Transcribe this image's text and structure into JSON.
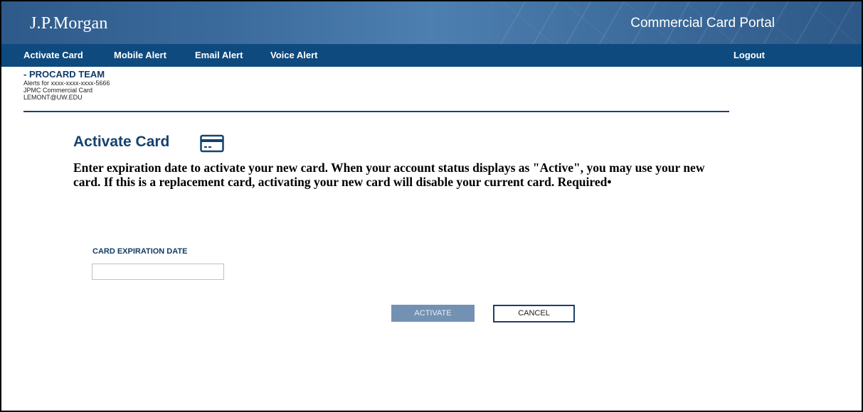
{
  "header": {
    "logo": "J.P.Morgan",
    "portal_title": "Commercial Card Portal"
  },
  "nav": {
    "items": [
      {
        "label": "Activate Card"
      },
      {
        "label": "Mobile Alert"
      },
      {
        "label": "Email Alert"
      },
      {
        "label": "Voice Alert"
      }
    ],
    "logout_label": "Logout"
  },
  "account": {
    "name": "- PROCARD TEAM",
    "alerts_for": "Alerts for xxxx-xxxx-xxxx-5666",
    "program": "JPMC Commercial Card",
    "email": "LEMONT@UW.EDU"
  },
  "main": {
    "title": "Activate Card",
    "title_icon": "credit-card-icon",
    "instructions": "Enter expiration date to activate your new card. When your account status displays as \"Active\", you may use your new card. If this is a replacement card, activating your new card will disable your current card. Required•",
    "field_label": "CARD EXPIRATION DATE",
    "field_value": "",
    "activate_label": "ACTIVATE",
    "cancel_label": "CANCEL"
  },
  "colors": {
    "nav_bg": "#0f4a7e",
    "title": "#154270",
    "activate_bg": "#7391b3"
  }
}
